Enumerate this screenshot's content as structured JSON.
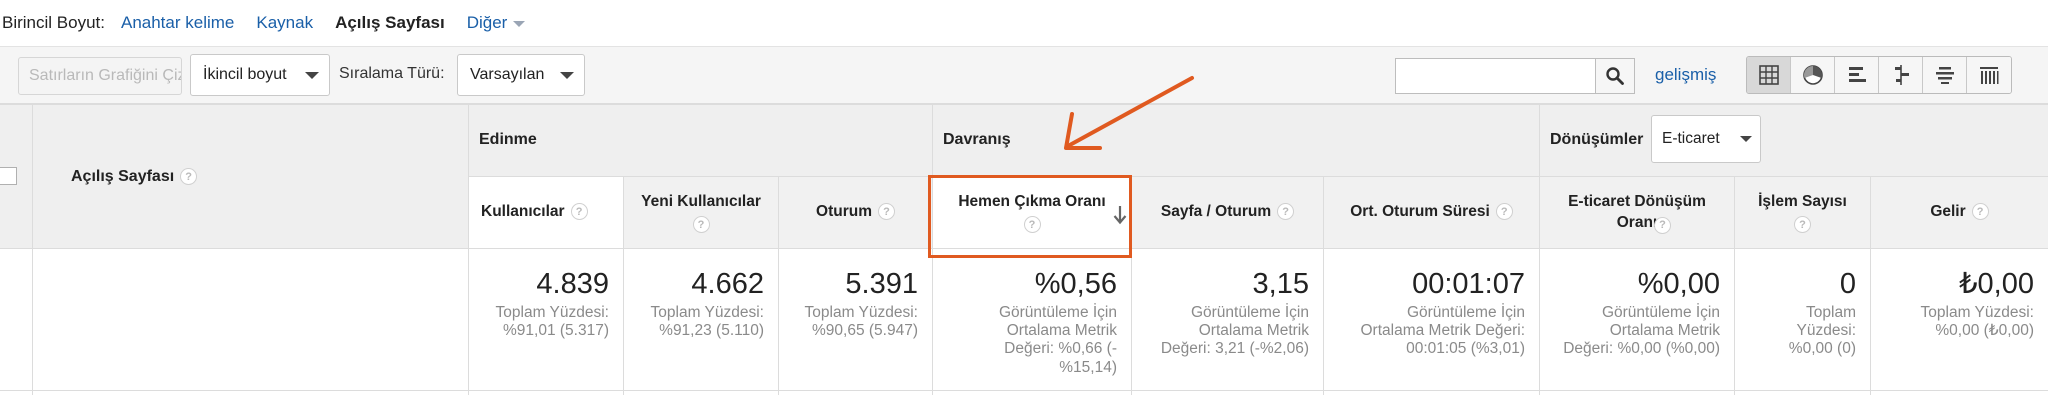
{
  "dimension_bar": {
    "label": "Birincil Boyut:",
    "options": [
      "Anahtar kelime",
      "Kaynak",
      "Açılış Sayfası",
      "Diğer"
    ],
    "active": "Açılış Sayfası"
  },
  "toolbar": {
    "graph_button": "Satırların Grafiğini Çiz",
    "secondary_dimension": "İkincil boyut",
    "sort_label": "Sıralama Türü:",
    "sort_value": "Varsayılan",
    "search_value": "",
    "advanced_link": "gelişmiş",
    "view_icons": [
      "table-view-icon",
      "pie-view-icon",
      "performance-view-icon",
      "comparison-view-icon",
      "term-cloud-view-icon",
      "pivot-view-icon"
    ]
  },
  "table": {
    "dimension_header": "Açılış Sayfası",
    "groups": {
      "acquisition": "Edinme",
      "behavior": "Davranış",
      "conversions": "Dönüşümler",
      "conversions_select": "E-ticaret"
    },
    "columns": [
      {
        "label": "Kullanıcılar",
        "total": "4.839",
        "sub": [
          "Toplam Yüzdesi:",
          "%91,01 (5.317)"
        ]
      },
      {
        "label": "Yeni Kullanıcılar",
        "total": "4.662",
        "sub": [
          "Toplam Yüzdesi:",
          "%91,23 (5.110)"
        ]
      },
      {
        "label": "Oturum",
        "total": "5.391",
        "sub": [
          "Toplam Yüzdesi:",
          "%90,65 (5.947)"
        ]
      },
      {
        "label": "Hemen Çıkma Oranı",
        "total": "%0,56",
        "sub": [
          "Görüntüleme İçin",
          "Ortalama Metrik",
          "Değeri: %0,66 (-",
          "%15,14)"
        ]
      },
      {
        "label": "Sayfa / Oturum",
        "total": "3,15",
        "sub": [
          "Görüntüleme İçin",
          "Ortalama Metrik",
          "Değeri: 3,21 (-%2,06)"
        ]
      },
      {
        "label": "Ort. Oturum Süresi",
        "total": "00:01:07",
        "sub": [
          "Görüntüleme İçin",
          "Ortalama Metrik Değeri:",
          "00:01:05 (%3,01)"
        ]
      },
      {
        "label": "E-ticaret Dönüşüm Oranı",
        "total": "%0,00",
        "sub": [
          "Görüntüleme İçin",
          "Ortalama Metrik",
          "Değeri: %0,00 (%0,00)"
        ]
      },
      {
        "label": "İşlem Sayısı",
        "total": "0",
        "sub": [
          "Toplam",
          "Yüzdesi:",
          "%0,00 (0)"
        ]
      },
      {
        "label": "Gelir",
        "total": "₺0,00",
        "sub": [
          "Toplam Yüzdesi:",
          "%0,00 (₺0,00)"
        ]
      }
    ],
    "help_glyph": "?"
  },
  "colors": {
    "link": "#1a5fa8",
    "annotation": "#e05a20"
  }
}
